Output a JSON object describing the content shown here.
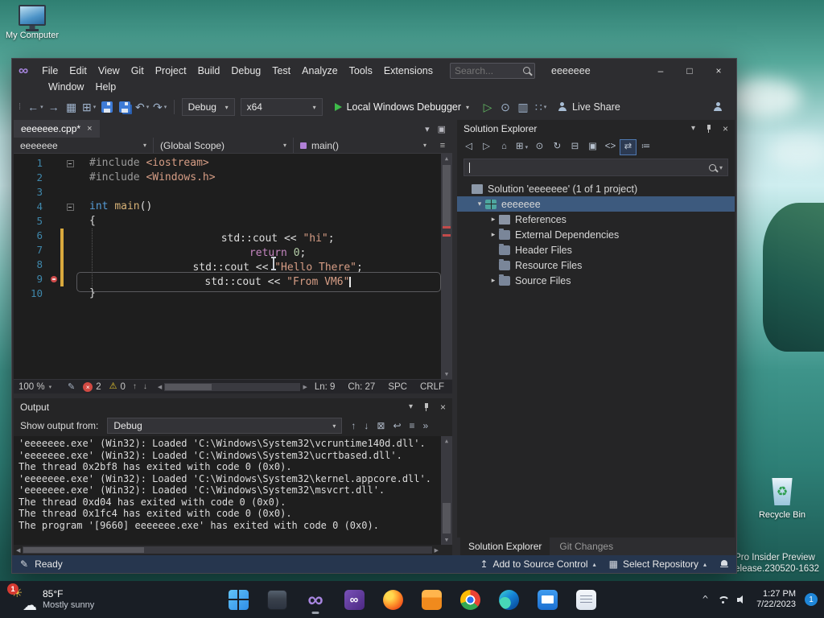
{
  "glyphs": {
    "caret_down": "▾",
    "caret_up": "▴",
    "chevron_up": "^",
    "up_arrow": "↑",
    "down_arrow": "↓",
    "left_arrow": "◀",
    "right_arrow": "▶",
    "scroll_up": "▲",
    "scroll_down": "▼",
    "close_x": "×",
    "upload": "↥",
    "repo_box": "▦",
    "pencil": "✎",
    "infinity": "∞",
    "sun": "☀",
    "cloud": "☁",
    "recycle": "♻"
  },
  "desktop": {
    "my_computer_label": "My Computer",
    "recycle_bin_label": "Recycle Bin",
    "watermark_line1": "Pro Insider Preview",
    "watermark_line2": "elease.230520-1632"
  },
  "titlebar": {
    "menus": [
      "File",
      "Edit",
      "View",
      "Git",
      "Project",
      "Build",
      "Debug",
      "Test",
      "Analyze",
      "Tools",
      "Extensions"
    ],
    "menus_row2": [
      "Window",
      "Help"
    ],
    "search_placeholder": "Search...",
    "window_title": "eeeeeee",
    "minimize": "–",
    "maximize": "□",
    "close": "×"
  },
  "toolbar": {
    "left_icons": [
      {
        "name": "navigate-backward-icon",
        "g": "←",
        "caret": true
      },
      {
        "name": "navigate-forward-icon",
        "g": "→"
      },
      {
        "name": "new-project-icon",
        "g": "▦"
      },
      {
        "name": "add-item-icon",
        "g": "⊞",
        "caret": true
      },
      {
        "name": "save-icon",
        "css": "floppy"
      },
      {
        "name": "save-all-icon",
        "css": "floppy floppy2"
      },
      {
        "name": "undo-icon",
        "g": "↶",
        "caret": true
      },
      {
        "name": "redo-icon",
        "g": "↷",
        "caret": true
      }
    ],
    "config": "Debug",
    "platform": "x64",
    "run_label": "Local Windows Debugger",
    "right_icons": [
      {
        "name": "start-without-debugging-icon",
        "g": "▷",
        "cls": "green"
      },
      {
        "name": "profiler-icon",
        "g": "⊙"
      },
      {
        "name": "attach-icon",
        "g": "▥"
      },
      {
        "name": "editor-columns-icon",
        "g": "∷",
        "caret": true
      }
    ],
    "live_share_label": "Live Share"
  },
  "editor": {
    "tab_title": "eeeeeee.cpp*",
    "tab_close": "×",
    "strip_icons": [
      {
        "name": "active-files-icon",
        "g": "▾"
      },
      {
        "name": "split-window-icon",
        "g": "▣"
      }
    ],
    "nav_project": "eeeeeee",
    "nav_scope": "(Global Scope)",
    "nav_member": "main()",
    "lines": [
      {
        "n": "1",
        "fold": true,
        "seg": [
          {
            "t": "#include ",
            "c": "pre"
          },
          {
            "t": "<iostream>",
            "c": "str"
          }
        ]
      },
      {
        "n": "2",
        "seg": [
          {
            "t": "#include ",
            "c": "pre"
          },
          {
            "t": "<Windows.h>",
            "c": "str"
          }
        ]
      },
      {
        "n": "3",
        "seg": []
      },
      {
        "n": "4",
        "fold": true,
        "seg": [
          {
            "t": "int",
            "c": "kw"
          },
          {
            "t": " ",
            "c": "pl"
          },
          {
            "t": "main",
            "c": "fn"
          },
          {
            "t": "()",
            "c": "pl"
          }
        ]
      },
      {
        "n": "5",
        "seg": [
          {
            "t": "{",
            "c": "pl"
          }
        ]
      },
      {
        "n": "6",
        "modc": "on",
        "ctc": "ig",
        "seg": [
          {
            "t": "    std::cout << ",
            "c": "pl"
          },
          {
            "t": "\"hi\"",
            "c": "str"
          },
          {
            "t": ";",
            "c": "pl"
          }
        ]
      },
      {
        "n": "7",
        "modc": "on",
        "ctc": "ig",
        "seg": [
          {
            "t": "    ",
            "c": "pl"
          },
          {
            "t": "return",
            "c": "kw2"
          },
          {
            "t": " ",
            "c": "pl"
          },
          {
            "t": "0",
            "c": "num"
          },
          {
            "t": ";",
            "c": "pl"
          }
        ]
      },
      {
        "n": "8",
        "modc": "on",
        "ctc": "ig",
        "seg": [
          {
            "t": "    std::cout << ",
            "c": "pl"
          },
          {
            "t": "\"Hello There\"",
            "c": "str"
          },
          {
            "t": ";",
            "c": "pl"
          }
        ]
      },
      {
        "n": "9",
        "modc": "on",
        "ctc": "ig cur",
        "err": true,
        "caret": true,
        "seg": [
          {
            "t": "    std::cout << ",
            "c": "pl"
          },
          {
            "t": "\"From VM6\"",
            "c": "str"
          }
        ]
      },
      {
        "n": "10",
        "seg": [
          {
            "t": "}",
            "c": "pl"
          }
        ]
      }
    ],
    "status": {
      "zoom": "100 %",
      "errors": "2",
      "warnings": "0",
      "line": "Ln: 9",
      "column": "Ch: 27",
      "spaces": "SPC",
      "eol": "CRLF"
    }
  },
  "output": {
    "title": "Output",
    "show_from_label": "Show output from:",
    "source": "Debug",
    "icons": [
      {
        "name": "goto-previous-message-icon",
        "g": "↑"
      },
      {
        "name": "goto-next-message-icon",
        "g": "↓"
      },
      {
        "name": "clear-all-icon",
        "g": "⊠"
      },
      {
        "name": "word-wrap-icon",
        "g": "↩"
      },
      {
        "name": "autoscroll-icon",
        "g": "≡"
      },
      {
        "name": "overflow-icon",
        "g": "»",
        "last": true
      }
    ],
    "lines": [
      "'eeeeeee.exe' (Win32): Loaded 'C:\\Windows\\System32\\vcruntime140d.dll'.",
      "'eeeeeee.exe' (Win32): Loaded 'C:\\Windows\\System32\\ucrtbased.dll'.",
      "The thread 0x2bf8 has exited with code 0 (0x0).",
      "'eeeeeee.exe' (Win32): Loaded 'C:\\Windows\\System32\\kernel.appcore.dll'.",
      "'eeeeeee.exe' (Win32): Loaded 'C:\\Windows\\System32\\msvcrt.dll'.",
      "The thread 0xd04 has exited with code 0 (0x0).",
      "The thread 0x1fc4 has exited with code 0 (0x0).",
      "The program '[9660] eeeeeee.exe' has exited with code 0 (0x0)."
    ]
  },
  "solution_explorer": {
    "title": "Solution Explorer",
    "toolbar": [
      {
        "name": "back-icon",
        "g": "◁"
      },
      {
        "name": "forward-icon",
        "g": "▷"
      },
      {
        "name": "home-icon",
        "g": "⌂"
      },
      {
        "name": "switch-views-icon",
        "g": "⊞",
        "caret": true
      },
      {
        "name": "pending-changes-icon",
        "g": "⊙"
      },
      {
        "name": "refresh-icon",
        "g": "↻"
      },
      {
        "name": "collapse-all-icon",
        "g": "⊟"
      },
      {
        "name": "show-all-files-icon",
        "g": "▣"
      },
      {
        "name": "code-view-icon",
        "g": "<>"
      },
      {
        "name": "sync-with-active-document-icon",
        "g": "⇄",
        "cls": "active"
      },
      {
        "name": "properties-icon",
        "g": "≔"
      }
    ],
    "tree": [
      {
        "label": "Solution 'eeeeeee' (1 of 1 project)",
        "level": 0,
        "arrow": "",
        "icon": "ic-solution",
        "iconname": "solution-icon"
      },
      {
        "label": "eeeeeee",
        "level": 1,
        "arrow": "▾",
        "icon": "ic-project",
        "iconname": "cpp-project-icon",
        "cls": "selected"
      },
      {
        "label": "References",
        "level": 2,
        "arrow": "▸",
        "icon": "ic-references",
        "iconname": "references-icon"
      },
      {
        "label": "External Dependencies",
        "level": 2,
        "arrow": "▸",
        "icon": "ic-folder",
        "iconname": "external-dependencies-folder-icon"
      },
      {
        "label": "Header Files",
        "level": 2,
        "arrow": "",
        "icon": "ic-folder",
        "iconname": "header-files-folder-icon"
      },
      {
        "label": "Resource Files",
        "level": 2,
        "arrow": "",
        "icon": "ic-folder",
        "iconname": "resource-files-folder-icon"
      },
      {
        "label": "Source Files",
        "level": 2,
        "arrow": "▸",
        "icon": "ic-folder",
        "iconname": "source-files-folder-icon"
      }
    ],
    "tabs": [
      {
        "label": "Solution Explorer",
        "name": "tab-solution-explorer",
        "cls": "active"
      },
      {
        "label": "Git Changes",
        "name": "tab-git-changes"
      }
    ]
  },
  "statusbar": {
    "ready": "Ready",
    "add_source_control": "Add to Source Control",
    "select_repository": "Select Repository"
  },
  "taskbar": {
    "weather_temp": "85°F",
    "weather_condition": "Mostly sunny",
    "weather_badge": "1",
    "icons": [
      {
        "name": "start-button",
        "cls": "tb-start"
      },
      {
        "name": "file-explorer",
        "cls": "tb-explorer"
      },
      {
        "name": "visual-studio",
        "cls": "tb-vs",
        "open": "open"
      },
      {
        "name": "visual-studio-installer",
        "cls": "tb-vsi"
      },
      {
        "name": "firefox",
        "cls": "tb-firefox"
      },
      {
        "name": "files-app",
        "cls": "tb-files"
      },
      {
        "name": "chrome",
        "cls": "tb-chrome"
      },
      {
        "name": "edge",
        "cls": "tb-edge"
      },
      {
        "name": "mail",
        "cls": "tb-mail"
      },
      {
        "name": "notepad",
        "cls": "tb-notepad"
      }
    ],
    "time": "1:27 PM",
    "date": "7/22/2023",
    "notification_count": "1"
  }
}
